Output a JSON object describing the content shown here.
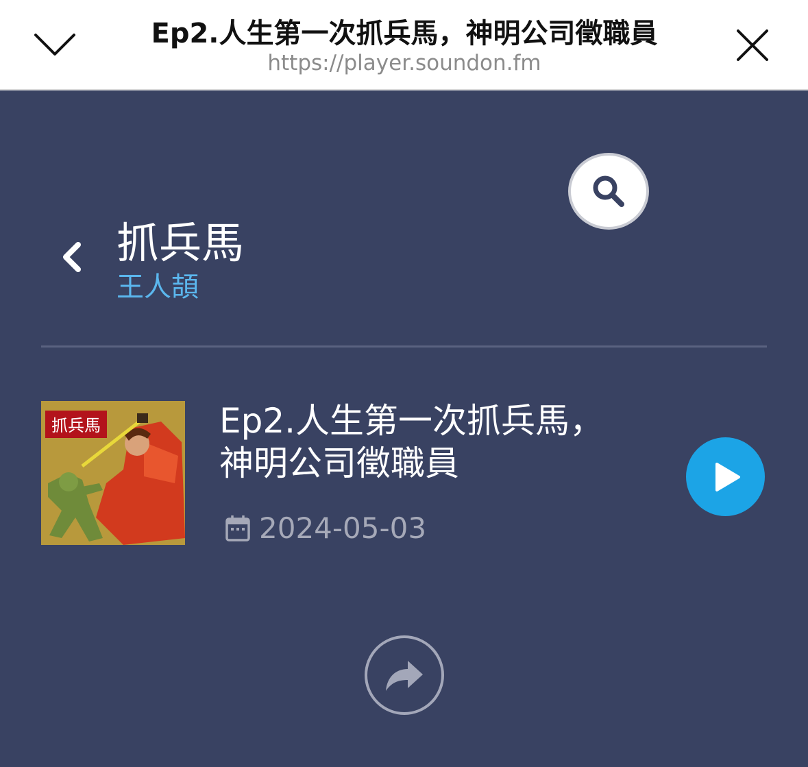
{
  "browser_bar": {
    "title": "Ep2.人生第一次抓兵馬，神明公司徵職員",
    "url": "https://player.soundon.fm"
  },
  "podcast": {
    "title": "抓兵馬",
    "author": "王人頡"
  },
  "episode": {
    "title_line1": "Ep2.人生第一次抓兵馬，",
    "title_line2": "神明公司徵職員",
    "date": "2024-05-03",
    "cover_text": "抓兵馬"
  },
  "colors": {
    "background": "#394262",
    "accent": "#1ca4e6",
    "author": "#5bb7ee"
  },
  "icons": [
    "chevron-down-icon",
    "close-icon",
    "search-icon",
    "back-chevron-icon",
    "calendar-icon",
    "play-icon",
    "share-icon"
  ]
}
